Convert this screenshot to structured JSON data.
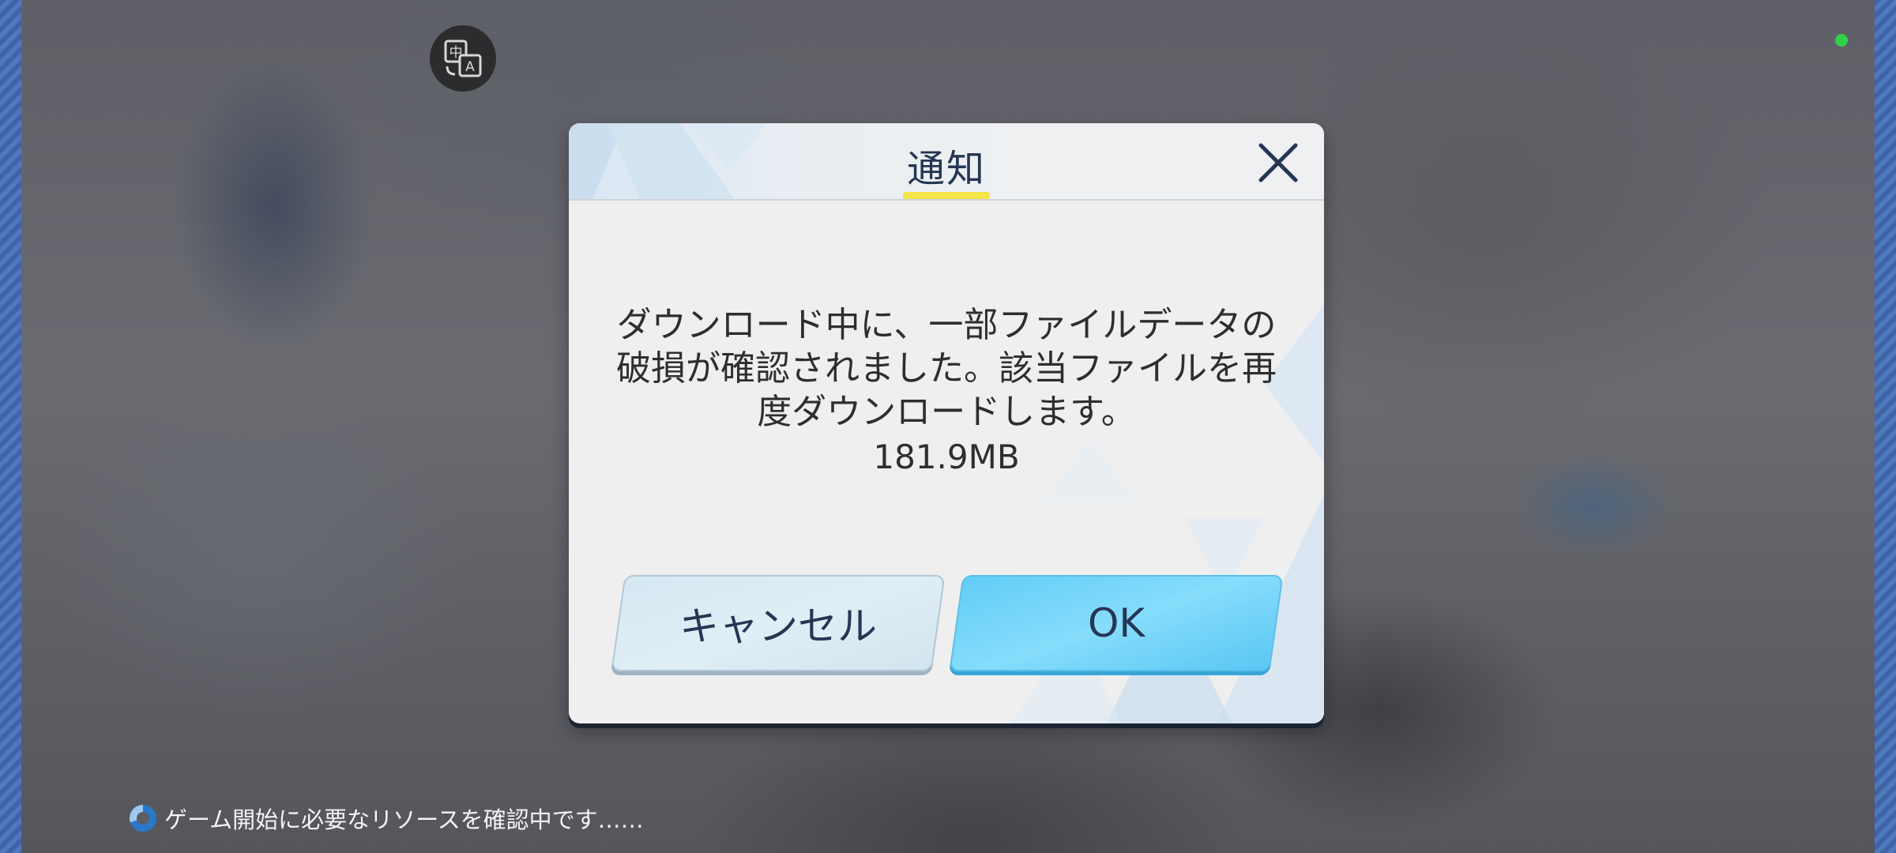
{
  "colors": {
    "dialog_bg": "#efeff0",
    "title_text": "#253654",
    "title_underline": "#f3e44a",
    "ok_button": "#62cdf6",
    "cancel_button": "#d5e8f2",
    "status_dot": "#2fd34a"
  },
  "overlay": {
    "translate_icon": "translate-icon",
    "status_indicator": "green-dot"
  },
  "dialog": {
    "title": "通知",
    "close_icon": "close-icon",
    "message_lines": [
      "ダウンロード中に、一部ファイルデータの",
      "破損が確認されました。該当ファイルを再",
      "度ダウンロードします。"
    ],
    "size": "181.9MB",
    "cancel_label": "キャンセル",
    "ok_label": "OK"
  },
  "footer": {
    "loading_text": "ゲーム開始に必要なリソースを確認中です……",
    "spinner_icon": "loading-spinner-icon"
  }
}
